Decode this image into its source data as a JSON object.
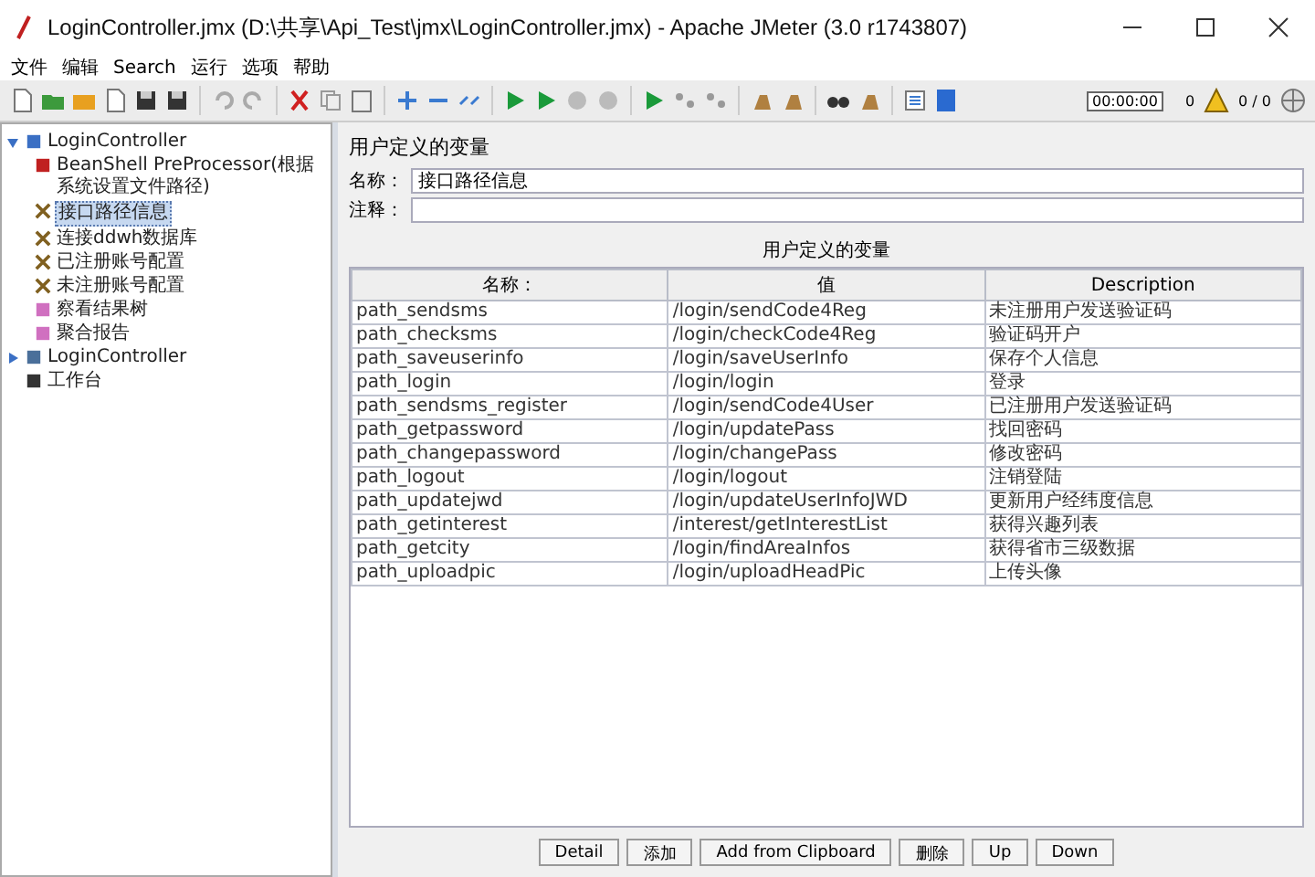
{
  "window": {
    "title": "LoginController.jmx (D:\\共享\\Api_Test\\jmx\\LoginController.jmx) - Apache JMeter (3.0 r1743807)"
  },
  "menu": [
    "文件",
    "编辑",
    "Search",
    "运行",
    "选项",
    "帮助"
  ],
  "status": {
    "timer": "00:00:00",
    "warnings": "0",
    "threads": "0 / 0"
  },
  "tree": [
    {
      "label": "LoginController",
      "kind": "testplan",
      "expanded": true,
      "selected": false,
      "children": [
        {
          "label": "BeanShell PreProcessor(根据系统设置文件路径)",
          "kind": "preprocessor",
          "selected": false
        },
        {
          "label": "接口路径信息",
          "kind": "config",
          "selected": true
        },
        {
          "label": "连接ddwh数据库",
          "kind": "config",
          "selected": false
        },
        {
          "label": "已注册账号配置",
          "kind": "config",
          "selected": false
        },
        {
          "label": "未注册账号配置",
          "kind": "config",
          "selected": false
        },
        {
          "label": "察看结果树",
          "kind": "listener",
          "selected": false
        },
        {
          "label": "聚合报告",
          "kind": "listener",
          "selected": false
        }
      ]
    },
    {
      "label": "LoginController",
      "kind": "threadgroup",
      "expanded": false,
      "selected": false
    },
    {
      "label": "工作台",
      "kind": "workbench",
      "selected": false
    }
  ],
  "panel": {
    "title": "用户定义的变量",
    "name_label": "名称：",
    "name_value": "接口路径信息",
    "comment_label": "注释：",
    "table_title": "用户定义的变量"
  },
  "table": {
    "columns": [
      "名称：",
      "值",
      "Description"
    ],
    "rows": [
      [
        "path_sendsms",
        "/login/sendCode4Reg",
        "未注册用户发送验证码"
      ],
      [
        "path_checksms",
        "/login/checkCode4Reg",
        "验证码开户"
      ],
      [
        "path_saveuserinfo",
        "/login/saveUserInfo",
        "保存个人信息"
      ],
      [
        "path_login",
        "/login/login",
        "登录"
      ],
      [
        "path_sendsms_register",
        "/login/sendCode4User",
        "已注册用户发送验证码"
      ],
      [
        "path_getpassword",
        "/login/updatePass",
        "找回密码"
      ],
      [
        "path_changepassword",
        "/login/changePass",
        "修改密码"
      ],
      [
        "path_logout",
        "/login/logout",
        "注销登陆"
      ],
      [
        "path_updatejwd",
        "/login/updateUserInfoJWD",
        "更新用户经纬度信息"
      ],
      [
        "path_getinterest",
        "/interest/getInterestList",
        "获得兴趣列表"
      ],
      [
        "path_getcity",
        "/login/findAreaInfos",
        "获得省市三级数据"
      ],
      [
        "path_uploadpic",
        "/login/uploadHeadPic",
        "上传头像"
      ]
    ]
  },
  "buttons": [
    "Detail",
    "添加",
    "Add from Clipboard",
    "删除",
    "Up",
    "Down"
  ]
}
